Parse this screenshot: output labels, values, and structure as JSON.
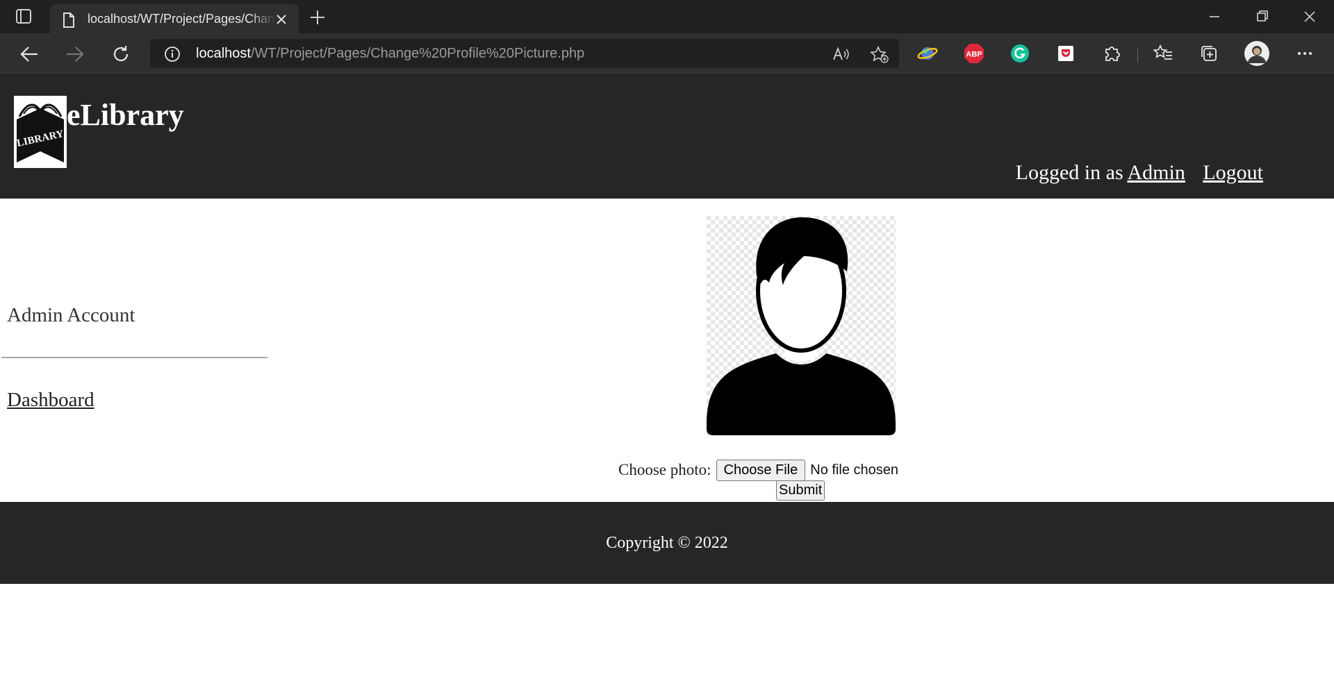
{
  "browser": {
    "tab_title": "localhost/WT/Project/Pages/Change Profile Picture.php",
    "url_host": "localhost",
    "url_path": "/WT/Project/Pages/Change%20Profile%20Picture.php",
    "icons": [
      "tab-actions-icon",
      "page-icon",
      "close-icon",
      "plus-icon",
      "minimize-icon",
      "restore-icon",
      "close-window-icon",
      "back-arrow-icon",
      "forward-arrow-icon",
      "refresh-icon",
      "info-icon",
      "read-aloud-icon",
      "add-favorite-icon",
      "extension-globe-icon",
      "adblock-plus-icon",
      "grammarly-icon",
      "pocket-icon",
      "extensions-puzzle-icon",
      "favorites-icon",
      "collections-icon",
      "profile-avatar-icon",
      "more-icon"
    ],
    "extensions": {
      "adblock_label": "ABP"
    }
  },
  "header": {
    "brand": "eLibrary",
    "logo_text": "LIBRARY",
    "logged_in_prefix": "Logged in as",
    "user_link": "Admin",
    "logout_link": "Logout"
  },
  "sidebar": {
    "title": "Admin Account",
    "items": [
      {
        "label": "Dashboard"
      }
    ]
  },
  "main": {
    "profile_image_alt": "default user avatar",
    "form": {
      "label": "Choose photo:",
      "file_button": "Choose File",
      "file_status": "No file chosen",
      "submit": "Submit"
    }
  },
  "footer": {
    "copyright": "Copyright © 2022"
  },
  "colors": {
    "header_bg": "#262626",
    "footer_bg": "#262626",
    "chrome_tabbar": "#202020",
    "chrome_toolbar": "#2f2f2f"
  }
}
